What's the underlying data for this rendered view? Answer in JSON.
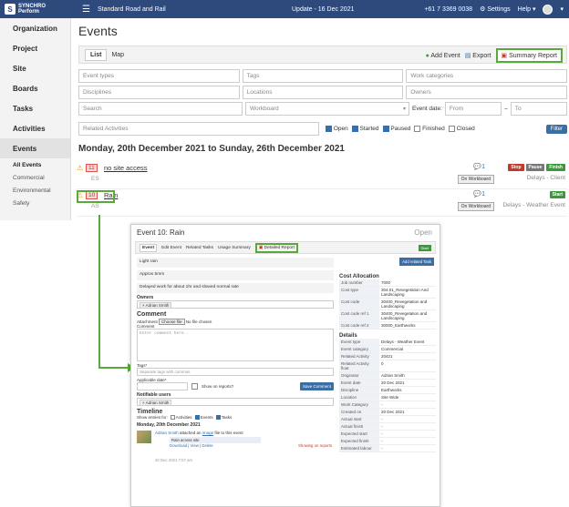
{
  "topbar": {
    "logo_line1": "SYNCHRO",
    "logo_line2": "Perform",
    "project": "Standard Road and Rail",
    "update": "Update - 16 Dec 2021",
    "phone": "+61 7 3369 0038",
    "settings": "Settings",
    "help": "Help"
  },
  "sidebar": {
    "items": [
      "Organization",
      "Project",
      "Site",
      "Boards",
      "Tasks",
      "Activities",
      "Events"
    ],
    "sub_items": [
      "All Events",
      "Commercial",
      "Environmental",
      "Safety"
    ]
  },
  "page": {
    "title": "Events",
    "tabs": [
      "List",
      "Map"
    ],
    "actions": {
      "add_event": "Add Event",
      "export": "Export",
      "summary_report": "Summary Report"
    }
  },
  "filters": {
    "row1": [
      "Event types",
      "Tags",
      "Work categories"
    ],
    "row2": [
      "Disciplines",
      "Locations",
      "Owners"
    ],
    "search": "Search",
    "workboard": "Workboard",
    "event_date_label": "Event date:",
    "from": "From",
    "to": "To",
    "related_activities": "Related Activities",
    "status_checks": [
      {
        "label": "Open",
        "checked": true
      },
      {
        "label": "Started",
        "checked": true
      },
      {
        "label": "Paused",
        "checked": true
      },
      {
        "label": "Finished",
        "checked": false
      },
      {
        "label": "Closed",
        "checked": false
      }
    ],
    "filter_button": "Filter"
  },
  "week_title": "Monday, 20th December 2021 to Sunday, 26th December 2021",
  "events": [
    {
      "num": "11",
      "name": "no site access",
      "owner": "ES",
      "comments": "1",
      "on_workboard": "On Workboard",
      "right_label": "Delays - Client",
      "buttons": [
        "Stop",
        "Pause",
        "Finish"
      ]
    },
    {
      "num": "10",
      "name": "Rain",
      "owner": "AS",
      "comments": "1",
      "on_workboard": "On Workboard",
      "right_label": "Delays - Weather Event",
      "buttons": [
        "Start"
      ]
    }
  ],
  "detail": {
    "title": "Event 10: Rain",
    "status": "Open",
    "tabs": [
      "Event",
      "Edit Event",
      "Related Tasks",
      "Usage Summary",
      "Detailed Report"
    ],
    "start_button": "Start",
    "desc1": "Light rain",
    "desc2": "Approx 5mm",
    "desc3": "Delayed work for about 1hr and slowed normal rate",
    "owners_label": "Owners",
    "owner": "Adrian Smith",
    "comment_title": "Comment",
    "attachment_label": "Attachment",
    "choose_file": "Choose file",
    "no_file": "No file chosen",
    "comment_label": "Comment",
    "comment_placeholder": "Enter comment here..",
    "tags_label": "Tags*",
    "tags_placeholder": "Separate tags with commas",
    "applicable_date": "Applicable date*",
    "show_on_reports": "Show on reports?",
    "save_comment": "Save Comment",
    "notifiable_users": "Notifiable users",
    "notifiable_user": "Adrian Smith",
    "timeline_title": "Timeline",
    "show_entries_for": "Show entries for:",
    "timeline_filters": [
      {
        "label": "Activities",
        "checked": false
      },
      {
        "label": "Events",
        "checked": true
      },
      {
        "label": "Tasks",
        "checked": true
      }
    ],
    "timeline_date": "Monday, 20th December 2021",
    "timeline_user": "Adrian Smith",
    "timeline_text_pre": "attached an",
    "timeline_link": "image",
    "timeline_text_post": "file to this event",
    "timeline_caption": "Rain across site",
    "timeline_actions": "Download | View | Delete",
    "showing_on_reports": "Showing on reports",
    "timeline_time": "20 Dec 2021 7:57 am",
    "add_related_task": "Add related Task",
    "cost_allocation_title": "Cost Allocation",
    "cost_allocation": [
      {
        "k": "Job number",
        "v": "7000"
      },
      {
        "k": "Cost type",
        "v": "304.01_Revegetation And Landscaping"
      },
      {
        "k": "Cost code",
        "v": "30400_Revegetation and Landscaping"
      },
      {
        "k": "Cost code ref 1",
        "v": "30400_Revegetation and Landscaping"
      },
      {
        "k": "Cost code ref 2",
        "v": "30000_Earthworks"
      }
    ],
    "details_title": "Details",
    "details": [
      {
        "k": "Event type",
        "v": "Delays - Weather Event"
      },
      {
        "k": "Event category",
        "v": "Commercial"
      },
      {
        "k": "Related Activity",
        "v": "20421"
      },
      {
        "k": "Related Activity float",
        "v": "0"
      },
      {
        "k": "Originator",
        "v": "Adrian Smith"
      },
      {
        "k": "Event date",
        "v": "20 Dec 2021"
      },
      {
        "k": "Discipline",
        "v": "Earthworks"
      },
      {
        "k": "Location",
        "v": "Site Wide"
      },
      {
        "k": "Work Category",
        "v": "-"
      },
      {
        "k": "Created on",
        "v": "20 Dec 2021"
      },
      {
        "k": "Actual start",
        "v": "-"
      },
      {
        "k": "Actual finish",
        "v": "-"
      },
      {
        "k": "Expected start",
        "v": "-"
      },
      {
        "k": "Expected finish",
        "v": "-"
      },
      {
        "k": "Estimated labour",
        "v": "-"
      }
    ]
  }
}
